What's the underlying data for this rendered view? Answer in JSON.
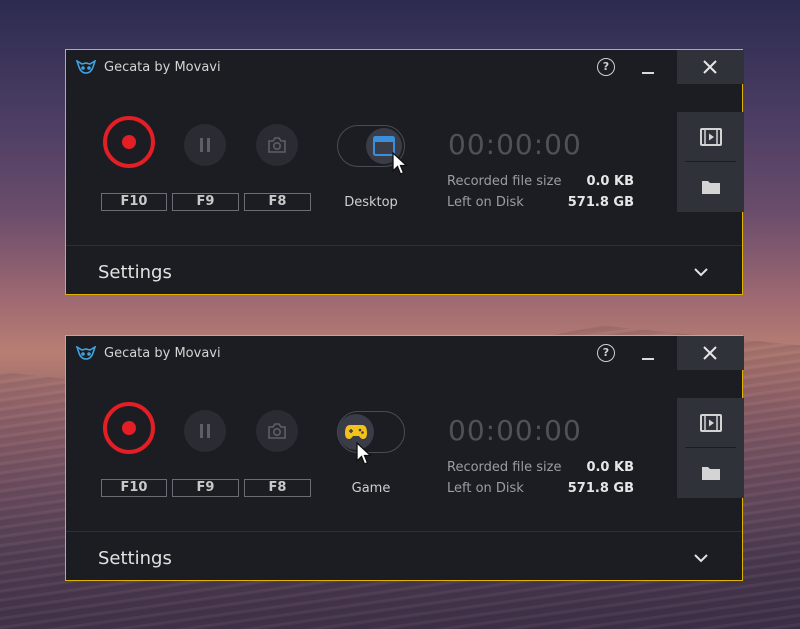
{
  "app_title": "Gecata by Movavi",
  "windows": [
    {
      "help_label": "?",
      "hotkeys": {
        "record": "F10",
        "pause": "F9",
        "screenshot": "F8"
      },
      "mode_label": "Desktop",
      "mode_icon": "desktop-window-icon",
      "mode_icon_color": "#3a8fd8",
      "timer": "00:00:00",
      "recorded_size_label": "Recorded file size",
      "recorded_size_value": "0.0 KB",
      "disk_label": "Left on Disk",
      "disk_value": "571.8 GB",
      "settings_label": "Settings"
    },
    {
      "help_label": "?",
      "hotkeys": {
        "record": "F10",
        "pause": "F9",
        "screenshot": "F8"
      },
      "mode_label": "Game",
      "mode_icon": "gamepad-icon",
      "mode_icon_color": "#f2c21a",
      "timer": "00:00:00",
      "recorded_size_label": "Recorded file size",
      "recorded_size_value": "0.0 KB",
      "disk_label": "Left on Disk",
      "disk_value": "571.8 GB",
      "settings_label": "Settings"
    }
  ],
  "colors": {
    "accent_border": "#e0b300",
    "record_red": "#e31f25",
    "window_bg": "#1c1d22"
  }
}
